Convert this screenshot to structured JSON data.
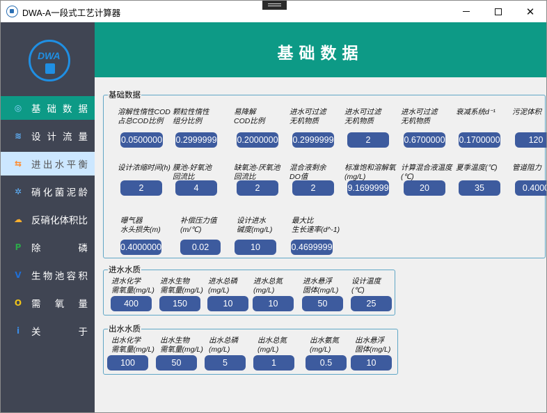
{
  "window": {
    "title": "DWA-A一段式工艺计算器"
  },
  "sidebar": {
    "logo_text": "DWA",
    "items": [
      {
        "label": "基础数据",
        "icon": "droplet-settings-icon"
      },
      {
        "label": "设计流量",
        "icon": "water-flow-icon"
      },
      {
        "label": "进出水平衡",
        "icon": "balance-icon"
      },
      {
        "label": "硝化菌泥龄",
        "icon": "nitrifier-icon"
      },
      {
        "label": "反硝化体积比",
        "icon": "cloud-gear-icon"
      },
      {
        "label": "除磷",
        "icon": "p-badge-icon"
      },
      {
        "label": "生物池容积",
        "icon": "v-badge-icon"
      },
      {
        "label": "需氧量",
        "icon": "oxygen-icon"
      },
      {
        "label": "关于",
        "icon": "info-icon"
      }
    ]
  },
  "header": {
    "title": "基础数据"
  },
  "basic": {
    "title": "基础数据",
    "fields": [
      {
        "label": "溶解性惰性COD\n占总COD比例",
        "value": "0.0500000"
      },
      {
        "label": "颗粒性惰性\n组分比例",
        "value": "0.2999999"
      },
      {
        "label": "易降解\nCOD比例",
        "value": "0.2000000"
      },
      {
        "label": "进水可过滤\n无机物质",
        "value": "0.2999999"
      },
      {
        "label": "进水可过滤\n无机物质",
        "value": "2"
      },
      {
        "label": "进水可过滤\n无机物质",
        "value": "0.6700000"
      },
      {
        "label": "衰减系统d⁻¹",
        "value": "0.1700000"
      },
      {
        "label": "污泥体积",
        "value": "120"
      },
      {
        "label": "设计浓缩时间(h)",
        "value": "2"
      },
      {
        "label": "膜池-好氧池\n回流比",
        "value": "4"
      },
      {
        "label": "缺氧池-厌氧池\n回流比",
        "value": "2"
      },
      {
        "label": "混合液剩余\nDO值",
        "value": "2"
      },
      {
        "label": "标准饱和溶解氧\n(mg/L)",
        "value": "9.1699999"
      },
      {
        "label": "计算混合液温度\n(℃)",
        "value": "20"
      },
      {
        "label": "夏季温度(℃)",
        "value": "35"
      },
      {
        "label": "管道阻力",
        "value": "0.4000"
      },
      {
        "label": "曝气器\n水头损失(m)",
        "value": "0.4000000"
      },
      {
        "label": "补偿压力值\n(m/℃)",
        "value": "0.02"
      },
      {
        "label": "设计进水\n碱度(mg/L)",
        "value": "10"
      },
      {
        "label": "最大比\n生长速率(d^-1)",
        "value": "0.4699999"
      }
    ]
  },
  "influent": {
    "title": "进水水质",
    "fields": [
      {
        "label": "进水化学\n需氧量(mg/L)",
        "value": "400"
      },
      {
        "label": "进水生物\n需氧量(mg/L)",
        "value": "150"
      },
      {
        "label": "进水总磷\n(mg/L)",
        "value": "10"
      },
      {
        "label": "进水总氮\n(mg/L)",
        "value": "10"
      },
      {
        "label": "进水悬浮\n固体(mg/L)",
        "value": "50"
      },
      {
        "label": "设计温度\n(℃)",
        "value": "25"
      }
    ]
  },
  "effluent": {
    "title": "出水水质",
    "fields": [
      {
        "label": "出水化学\n需氧量(mg/L)",
        "value": "100"
      },
      {
        "label": "出水生物\n需氧量(mg/L)",
        "value": "50"
      },
      {
        "label": "出水总磷\n(mg/L)",
        "value": "5"
      },
      {
        "label": "出水总氮\n(mg/L)",
        "value": "1"
      },
      {
        "label": "出水氨氮\n(mg/L)",
        "value": "0.5"
      },
      {
        "label": "出水悬浮\n固体(mg/L)",
        "value": "10"
      }
    ]
  },
  "colors": {
    "accent": "#0d9a86",
    "sidebar": "#404553",
    "input": "#3d5b9e",
    "hover": "#cce7ff"
  }
}
